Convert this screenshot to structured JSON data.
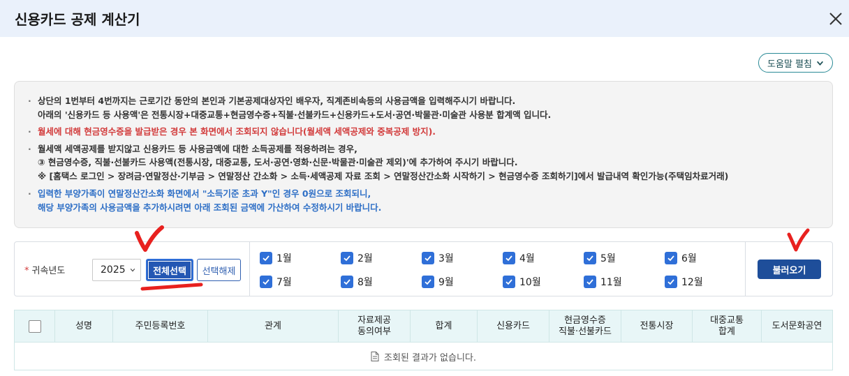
{
  "window": {
    "title": "신용카드 공제 계산기"
  },
  "help_button": {
    "label": "도움말 펼침"
  },
  "notices": [
    {
      "text": "상단의 1번부터 4번까지는 근로기간 동안의 본인과 기본공제대상자인 배우자, 직계존비속등의 사용금액을 입력해주시기 바랍니다.",
      "style": "normal",
      "bullet": true
    },
    {
      "text": "아래의 '신용카드 등 사용액'은 전통시장+대중교통+현금영수증+직불·선불카드+신용카드+도서·공연·박물관·미술관 사용분 합계액 입니다.",
      "style": "normal",
      "bullet": false
    },
    {
      "text": "월세에 대해 현금영수증을 발급받은 경우 본 화면에서 조회되지 않습니다(월세액 세액공제와 중복공제 방지).",
      "style": "red",
      "bullet": true
    },
    {
      "text": "월세액 세액공제를 받지않고 신용카드 등 사용금액에 대한 소득공제를 적용하려는 경우,",
      "style": "normal",
      "bullet": true
    },
    {
      "text": "③ 현금영수증, 직불·선불카드 사용액(전통시장, 대중교통, 도서·공연·영화·신문·박물관·미술관 제외)'에 추가하여 주시기 바랍니다.",
      "style": "normal",
      "bullet": false
    },
    {
      "text": "※ [홈택스 로그인 > 장려금·연말정산·기부금 > 연말정산 간소화 > 소득·세액공제 자료 조회 > 연말정산간소화 시작하기 > 현금영수증 조회하기]에서 발급내역 확인가능(주택임차료거래)",
      "style": "normal",
      "bullet": false
    },
    {
      "text": "입력한 부양가족이 연말정산간소화 화면에서 \"소득기준 초과 Y\"인 경우 0원으로 조회되니,",
      "style": "blue",
      "bullet": true
    },
    {
      "text": "해당 부양가족의 사용금액을 추가하시려면 아래 조회된 금액에 가산하여 수정하시기 바랍니다.",
      "style": "blue",
      "bullet": false
    }
  ],
  "filter": {
    "required_mark": "*",
    "year_label": "귀속년도",
    "year_value": "2025",
    "select_all_label": "전체선택",
    "deselect_label": "선택해제",
    "months": [
      "1월",
      "2월",
      "3월",
      "4월",
      "5월",
      "6월",
      "7월",
      "8월",
      "9월",
      "10월",
      "11월",
      "12월"
    ],
    "months_checked": [
      true,
      true,
      true,
      true,
      true,
      true,
      true,
      true,
      true,
      true,
      true,
      true
    ],
    "load_label": "불러오기"
  },
  "table": {
    "headers": [
      "성명",
      "주민등록번호",
      "관계",
      "자료제공\n동의여부",
      "합계",
      "신용카드",
      "현금영수증\n직불·선불카드",
      "전통시장",
      "대중교통\n합계",
      "도서문화공연"
    ],
    "empty_message": "조회된 결과가 없습니다."
  },
  "colors": {
    "accent": "#2457b3",
    "checkbox": "#2f6fd8",
    "notice_red": "#d23c3c",
    "notice_blue": "#2e6fc6",
    "annotation_red": "#e8211f",
    "header_bg": "#e8f6f7"
  }
}
